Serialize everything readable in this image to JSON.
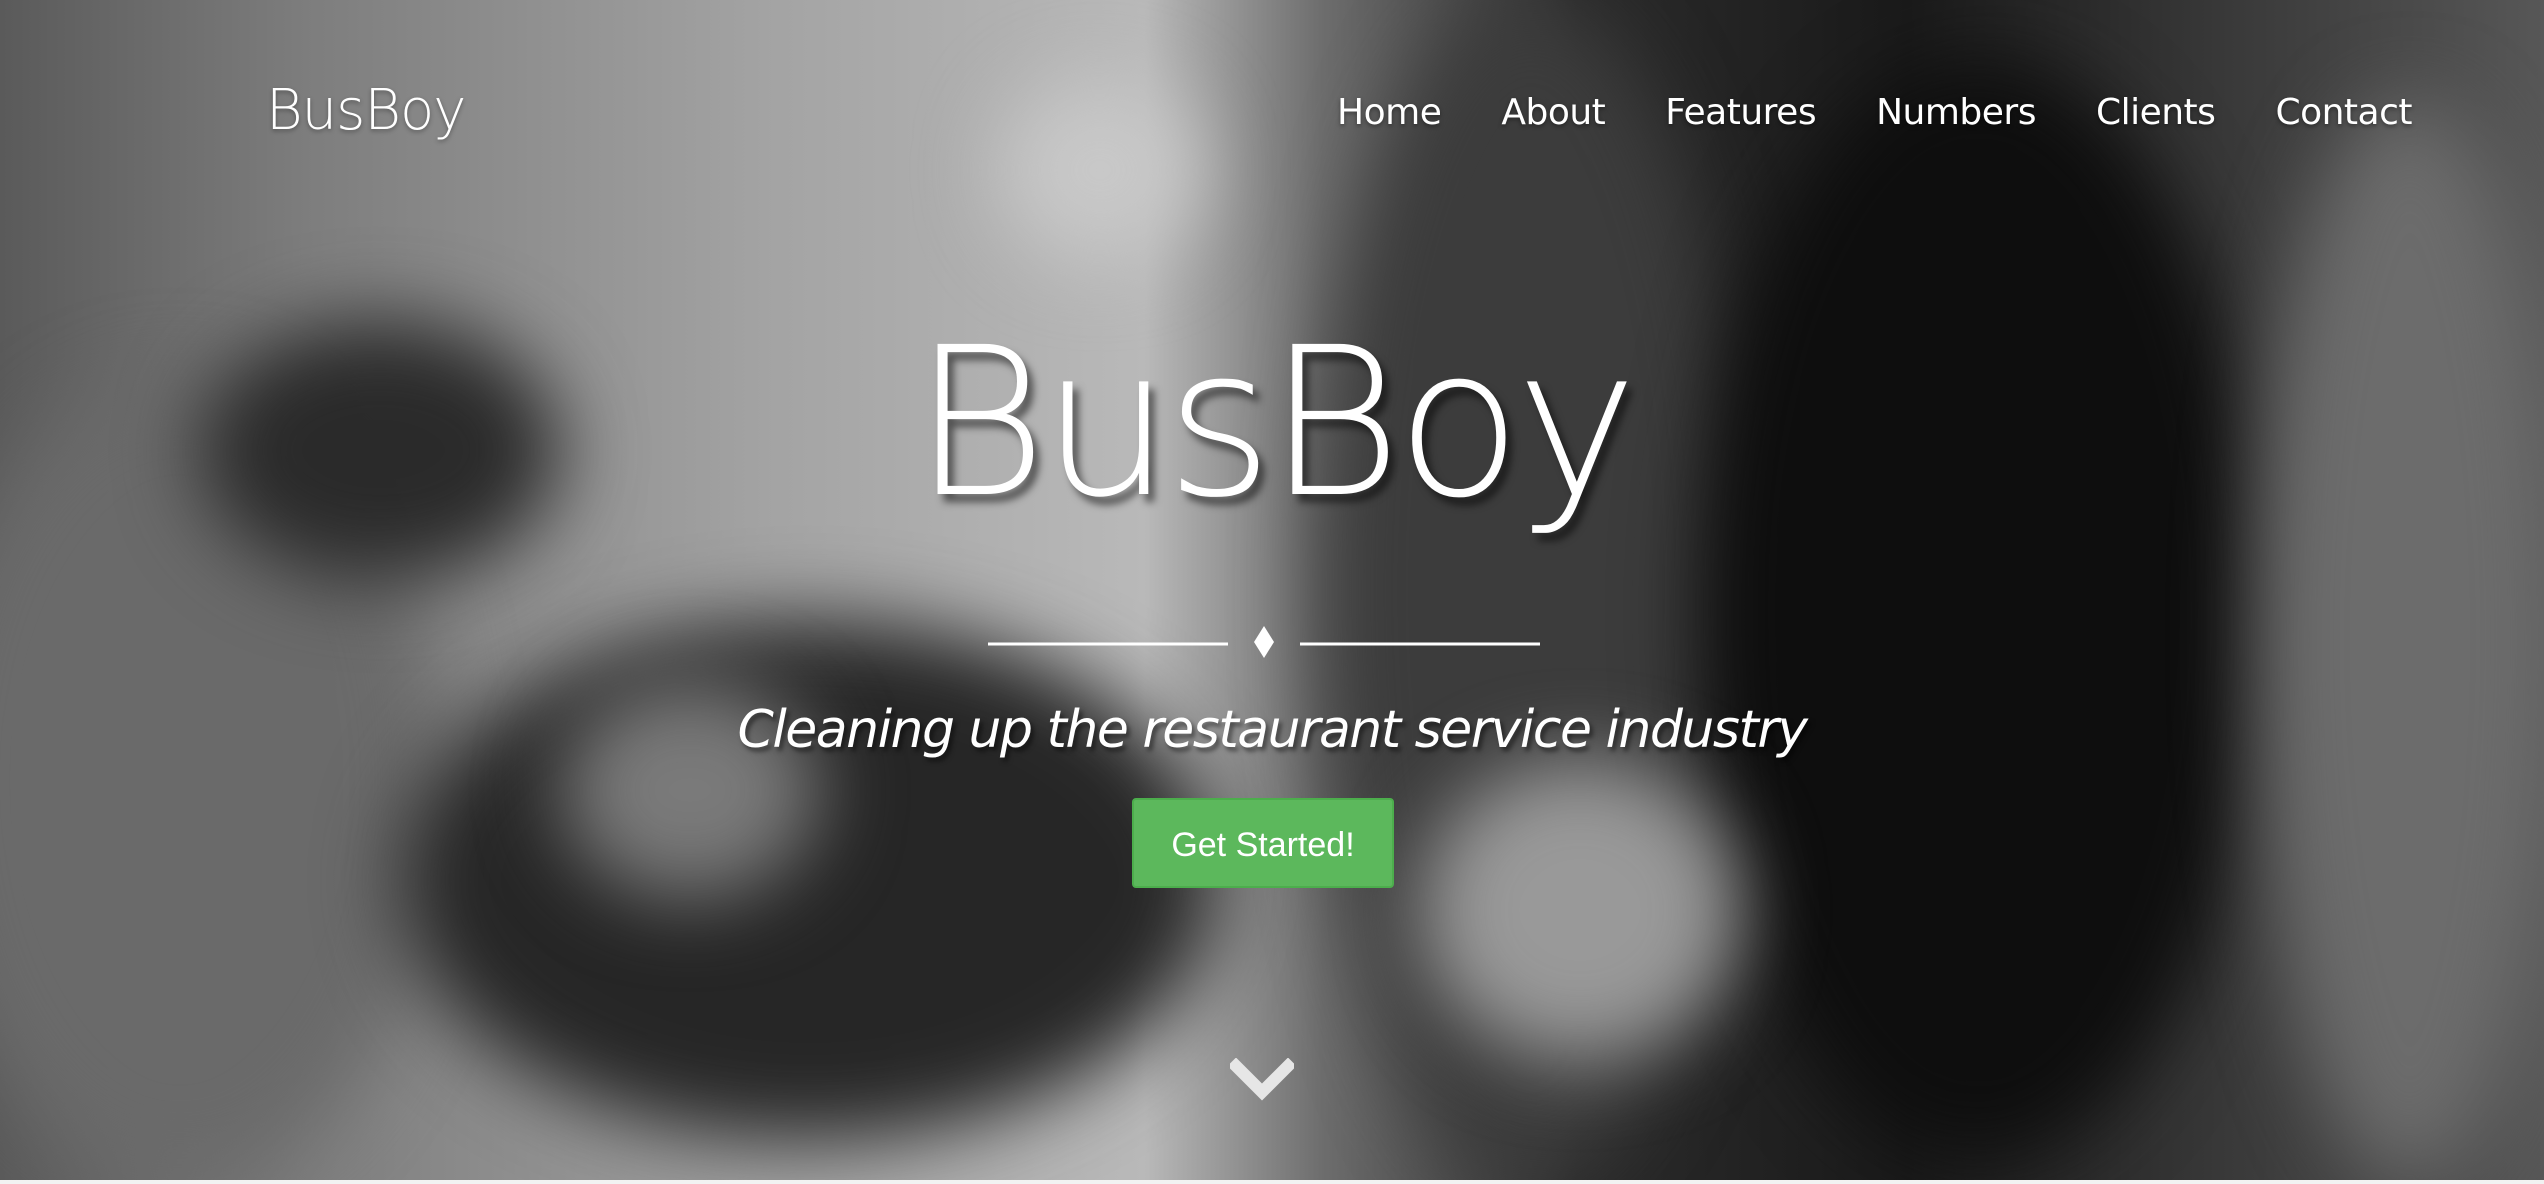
{
  "header": {
    "brand": "BusBoy"
  },
  "nav": {
    "items": [
      {
        "label": "Home"
      },
      {
        "label": "About"
      },
      {
        "label": "Features"
      },
      {
        "label": "Numbers"
      },
      {
        "label": "Clients"
      },
      {
        "label": "Contact"
      }
    ]
  },
  "hero": {
    "title": "BusBoy",
    "tagline": "Cleaning up the restaurant service industry",
    "cta_label": "Get Started!",
    "scroll_icon": "chevron-down-icon"
  },
  "colors": {
    "cta": "#5cb85c",
    "text": "#ffffff"
  }
}
